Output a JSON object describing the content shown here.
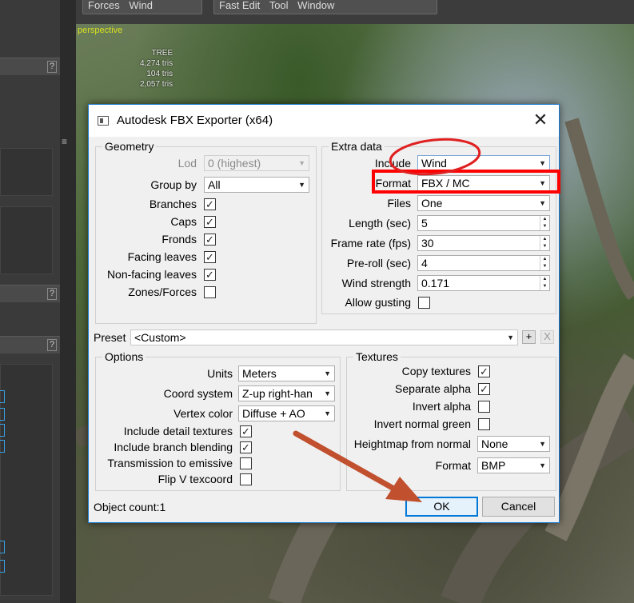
{
  "toolbar": {
    "group1": [
      "Forces",
      "Wind"
    ],
    "group2": [
      "Fast Edit",
      "Tool",
      "Window"
    ]
  },
  "viewport": {
    "mode": "perspective",
    "stats": [
      "TREE",
      "4,274 tris",
      "104 tris",
      "2,057 tris"
    ]
  },
  "dialog": {
    "title": "Autodesk FBX Exporter (x64)",
    "geometry": {
      "title": "Geometry",
      "lod_label": "Lod",
      "lod_value": "0 (highest)",
      "groupby_label": "Group by",
      "groupby_value": "All",
      "checks": [
        {
          "label": "Branches",
          "checked": true
        },
        {
          "label": "Caps",
          "checked": true
        },
        {
          "label": "Fronds",
          "checked": true
        },
        {
          "label": "Facing leaves",
          "checked": true
        },
        {
          "label": "Non-facing leaves",
          "checked": true
        },
        {
          "label": "Zones/Forces",
          "checked": false
        }
      ]
    },
    "extra": {
      "title": "Extra data",
      "include_label": "Include",
      "include_value": "Wind",
      "format_label": "Format",
      "format_value": "FBX / MC",
      "files_label": "Files",
      "files_value": "One",
      "length_label": "Length (sec)",
      "length_value": "5",
      "framerate_label": "Frame rate (fps)",
      "framerate_value": "30",
      "preroll_label": "Pre-roll (sec)",
      "preroll_value": "4",
      "windstrength_label": "Wind strength",
      "windstrength_value": "0.171",
      "allowgusting_label": "Allow gusting",
      "allowgusting_checked": false
    },
    "preset": {
      "label": "Preset",
      "value": "<Custom>",
      "add": "+",
      "remove": "X"
    },
    "options": {
      "title": "Options",
      "units_label": "Units",
      "units_value": "Meters",
      "coord_label": "Coord system",
      "coord_value": "Z-up right-han",
      "vcolor_label": "Vertex color",
      "vcolor_value": "Diffuse + AO",
      "checks": [
        {
          "label": "Include detail textures",
          "checked": true
        },
        {
          "label": "Include branch blending",
          "checked": true
        },
        {
          "label": "Transmission to emissive",
          "checked": false
        },
        {
          "label": "Flip V texcoord",
          "checked": false
        }
      ]
    },
    "textures": {
      "title": "Textures",
      "checks": [
        {
          "label": "Copy textures",
          "checked": true
        },
        {
          "label": "Separate alpha",
          "checked": true
        },
        {
          "label": "Invert alpha",
          "checked": false
        },
        {
          "label": "Invert normal green",
          "checked": false
        }
      ],
      "heightmap_label": "Heightmap from normal",
      "heightmap_value": "None",
      "format_label": "Format",
      "format_value": "BMP"
    },
    "object_count": "Object count:1",
    "ok": "OK",
    "cancel": "Cancel"
  },
  "colors": {
    "annotation_red": "#ff0000",
    "arrow": "#c0502e",
    "accent": "#0078d7"
  }
}
